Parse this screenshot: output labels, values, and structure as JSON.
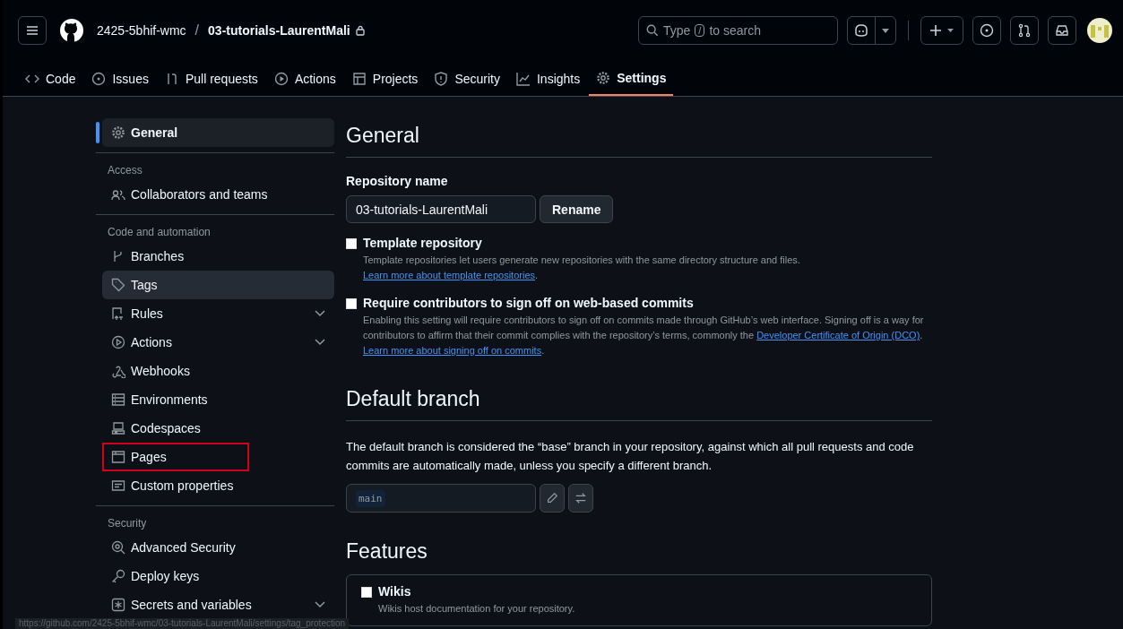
{
  "header": {
    "owner": "2425-5bhif-wmc",
    "separator": "/",
    "repo": "03-tutorials-LaurentMali",
    "search": {
      "before": "Type",
      "key": "/",
      "after": "to search"
    }
  },
  "tabs": [
    {
      "label": "Code",
      "selected": false
    },
    {
      "label": "Issues",
      "selected": false
    },
    {
      "label": "Pull requests",
      "selected": false
    },
    {
      "label": "Actions",
      "selected": false
    },
    {
      "label": "Projects",
      "selected": false
    },
    {
      "label": "Security",
      "selected": false
    },
    {
      "label": "Insights",
      "selected": false
    },
    {
      "label": "Settings",
      "selected": true
    }
  ],
  "sidebar": [
    {
      "items": [
        {
          "label": "General",
          "selected": true,
          "hovered": false,
          "expandable": false,
          "highlighted": false
        }
      ]
    },
    {
      "heading": "Access",
      "items": [
        {
          "label": "Collaborators and teams",
          "selected": false,
          "hovered": false,
          "expandable": false,
          "highlighted": false
        }
      ]
    },
    {
      "heading": "Code and automation",
      "items": [
        {
          "label": "Branches",
          "selected": false,
          "hovered": false,
          "expandable": false,
          "highlighted": false
        },
        {
          "label": "Tags",
          "selected": false,
          "hovered": true,
          "expandable": false,
          "highlighted": false
        },
        {
          "label": "Rules",
          "selected": false,
          "hovered": false,
          "expandable": true,
          "highlighted": false
        },
        {
          "label": "Actions",
          "selected": false,
          "hovered": false,
          "expandable": true,
          "highlighted": false
        },
        {
          "label": "Webhooks",
          "selected": false,
          "hovered": false,
          "expandable": false,
          "highlighted": false
        },
        {
          "label": "Environments",
          "selected": false,
          "hovered": false,
          "expandable": false,
          "highlighted": false
        },
        {
          "label": "Codespaces",
          "selected": false,
          "hovered": false,
          "expandable": false,
          "highlighted": false
        },
        {
          "label": "Pages",
          "selected": false,
          "hovered": false,
          "expandable": false,
          "highlighted": true
        },
        {
          "label": "Custom properties",
          "selected": false,
          "hovered": false,
          "expandable": false,
          "highlighted": false
        }
      ]
    },
    {
      "heading": "Security",
      "items": [
        {
          "label": "Advanced Security",
          "selected": false,
          "hovered": false,
          "expandable": false,
          "highlighted": false
        },
        {
          "label": "Deploy keys",
          "selected": false,
          "hovered": false,
          "expandable": false,
          "highlighted": false
        },
        {
          "label": "Secrets and variables",
          "selected": false,
          "hovered": false,
          "expandable": true,
          "highlighted": false
        }
      ]
    }
  ],
  "general": {
    "title": "General",
    "repo_name_label": "Repository name",
    "repo_name_value": "03-tutorials-LaurentMali",
    "rename_button": "Rename",
    "options": [
      {
        "title": "Template repository",
        "checked": false,
        "description": [
          {
            "text": "Template repositories let users generate new repositories with the same directory structure and files. "
          },
          {
            "link": "Learn more about template repositories"
          },
          {
            "text": "."
          }
        ]
      },
      {
        "title": "Require contributors to sign off on web-based commits",
        "checked": false,
        "description": [
          {
            "text": "Enabling this setting will require contributors to sign off on commits made through GitHub’s web interface. Signing off is a way for contributors to affirm that their commit complies with the repository’s terms, commonly the "
          },
          {
            "link": "Developer Certificate of Origin (DCO)"
          },
          {
            "text": ". "
          },
          {
            "link": "Learn more about signing off on commits"
          },
          {
            "text": "."
          }
        ]
      }
    ]
  },
  "default_branch": {
    "title": "Default branch",
    "description": "The default branch is considered the “base” branch in your repository, against which all pull requests and code commits are automatically made, unless you specify a different branch.",
    "branch": "main"
  },
  "features": {
    "title": "Features",
    "items": [
      {
        "title": "Wikis",
        "checked": false,
        "description": "Wikis host documentation for your repository."
      }
    ]
  },
  "status_url": "https://github.com/2425-5bhif-wmc/03-tutorials-LaurentMali/settings/tag_protection"
}
